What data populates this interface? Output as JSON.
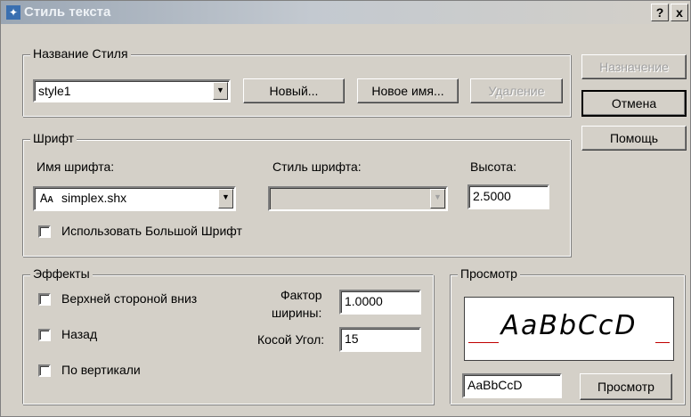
{
  "window": {
    "title": "Стиль текста",
    "help_label": "?",
    "close_label": "x"
  },
  "style_name": {
    "group_label": "Название Стиля",
    "selected": "style1",
    "new_label": "Новый...",
    "rename_label": "Новое имя...",
    "delete_label": "Удаление"
  },
  "side_buttons": {
    "apply_label": "Назначение",
    "cancel_label": "Отмена",
    "help_label": "Помощь"
  },
  "font": {
    "group_label": "Шрифт",
    "name_label": "Имя шрифта:",
    "name_value": "simplex.shx",
    "style_label": "Стиль шрифта:",
    "style_value": "",
    "height_label": "Высота:",
    "height_value": "2.5000",
    "bigfont_label": "Использовать Большой Шрифт"
  },
  "effects": {
    "group_label": "Эффекты",
    "upside_down_label": "Верхней стороной вниз",
    "backwards_label": "Назад",
    "vertical_label": "По вертикали",
    "width_label_1": "Фактор",
    "width_label_2": "ширины:",
    "width_value": "1.0000",
    "oblique_label": "Косой Угол:",
    "oblique_value": "15"
  },
  "preview": {
    "group_label": "Просмотр",
    "sample_text": "AaBbCcD",
    "input_value": "AaBbCcD",
    "button_label": "Просмотр"
  },
  "colors": {
    "preview_line": "#c00000",
    "title_gradient_start": "#9aa6b4"
  }
}
